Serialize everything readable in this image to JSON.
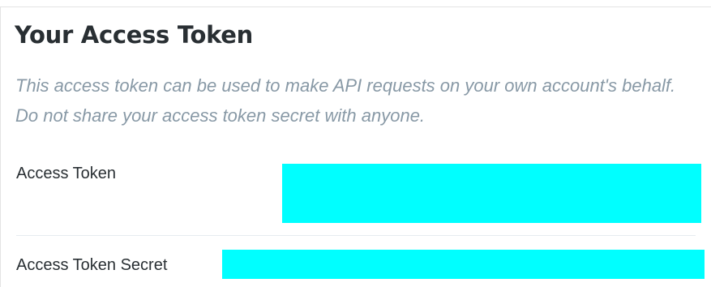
{
  "section": {
    "title": "Your Access Token",
    "description": "This access token can be used to make API requests on your own account's behalf. Do not share your access token secret with anyone."
  },
  "rows": [
    {
      "label": "Access Token"
    },
    {
      "label": "Access Token Secret"
    }
  ],
  "colors": {
    "redaction": "#00ffff",
    "title": "#292f33",
    "description": "#8899a6"
  }
}
